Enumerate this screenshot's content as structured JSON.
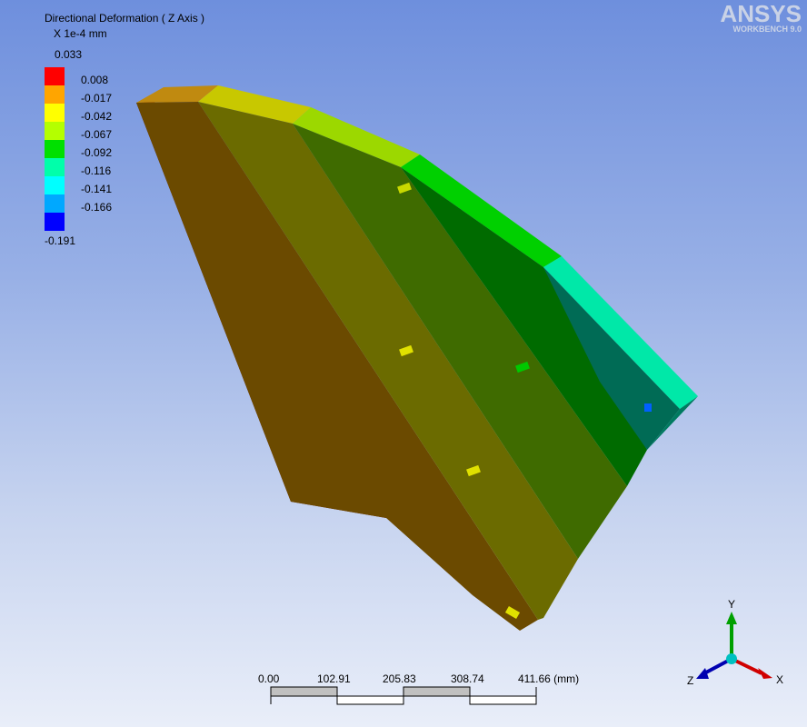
{
  "result": {
    "title": "Directional Deformation ( Z Axis )",
    "units": "X 1e-4 mm"
  },
  "legend": {
    "max": "0.033",
    "min": "-0.191",
    "bands": [
      {
        "label": "0.008",
        "color": "#ff0000"
      },
      {
        "label": "-0.017",
        "color": "#ffa500"
      },
      {
        "label": "-0.042",
        "color": "#ffff00"
      },
      {
        "label": "-0.067",
        "color": "#b4ff00"
      },
      {
        "label": "-0.092",
        "color": "#00e000"
      },
      {
        "label": "-0.116",
        "color": "#00ffaa"
      },
      {
        "label": "-0.141",
        "color": "#00ffff"
      },
      {
        "label": "-0.166",
        "color": "#00a8ff"
      },
      {
        "label": "",
        "color": "#0000ff"
      }
    ]
  },
  "logo": {
    "main": "ANSYS",
    "sub": "WORKBENCH 9.0"
  },
  "scale_bar": {
    "labels": [
      "0.00",
      "102.91",
      "205.83",
      "308.74",
      "411.66 (mm)"
    ]
  },
  "triad": {
    "x": "X",
    "y": "Y",
    "z": "Z"
  }
}
